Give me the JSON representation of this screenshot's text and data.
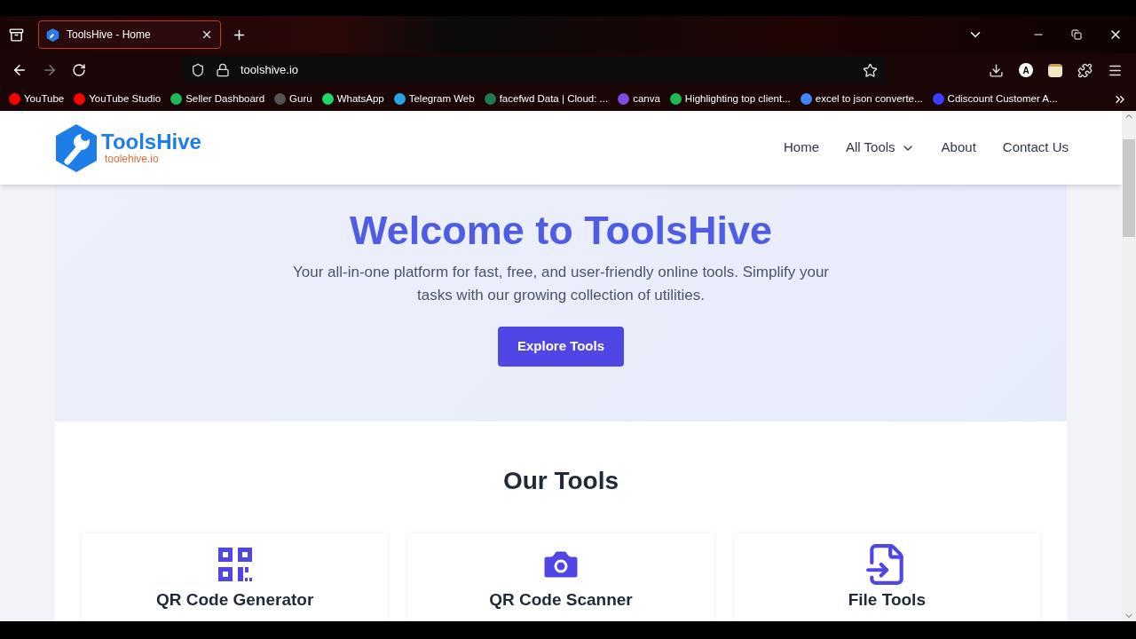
{
  "browser": {
    "tab": {
      "title": "ToolsHive - Home"
    },
    "url": "toolshive.io",
    "profile_initial": "A",
    "bookmarks": [
      {
        "label": "YouTube",
        "color": "#ff0000"
      },
      {
        "label": "YouTube Studio",
        "color": "#ff0000"
      },
      {
        "label": "Seller Dashboard",
        "color": "#1db954"
      },
      {
        "label": "Guru",
        "color": "#555555"
      },
      {
        "label": "WhatsApp",
        "color": "#25d366"
      },
      {
        "label": "Telegram Web",
        "color": "#2aa3e0"
      },
      {
        "label": "facefwd Data | Cloud: ...",
        "color": "#1f7a4d"
      },
      {
        "label": "canva",
        "color": "#7d4cdb"
      },
      {
        "label": "Highlighting top client...",
        "color": "#1db954"
      },
      {
        "label": "excel to json converte...",
        "color": "#4285f4"
      },
      {
        "label": "Cdiscount Customer A...",
        "color": "#3d3dff"
      }
    ]
  },
  "site": {
    "logo": {
      "name": "ToolsHive",
      "domain": "toolehive.io"
    },
    "nav": [
      {
        "label": "Home",
        "kind": "link"
      },
      {
        "label": "All Tools",
        "kind": "dropdown"
      },
      {
        "label": "About",
        "kind": "link"
      },
      {
        "label": "Contact Us",
        "kind": "link"
      }
    ],
    "hero": {
      "title": "Welcome to ToolsHive",
      "subtitle": "Your all-in-one platform for fast, free, and user-friendly online tools. Simplify your tasks with our growing collection of utilities.",
      "button": "Explore Tools"
    },
    "tools_section": {
      "title": "Our Tools",
      "tools": [
        {
          "name": "QR Code Generator",
          "kind": "qr"
        },
        {
          "name": "QR Code Scanner",
          "kind": "camera"
        },
        {
          "name": "File Tools",
          "kind": "file"
        }
      ]
    }
  }
}
